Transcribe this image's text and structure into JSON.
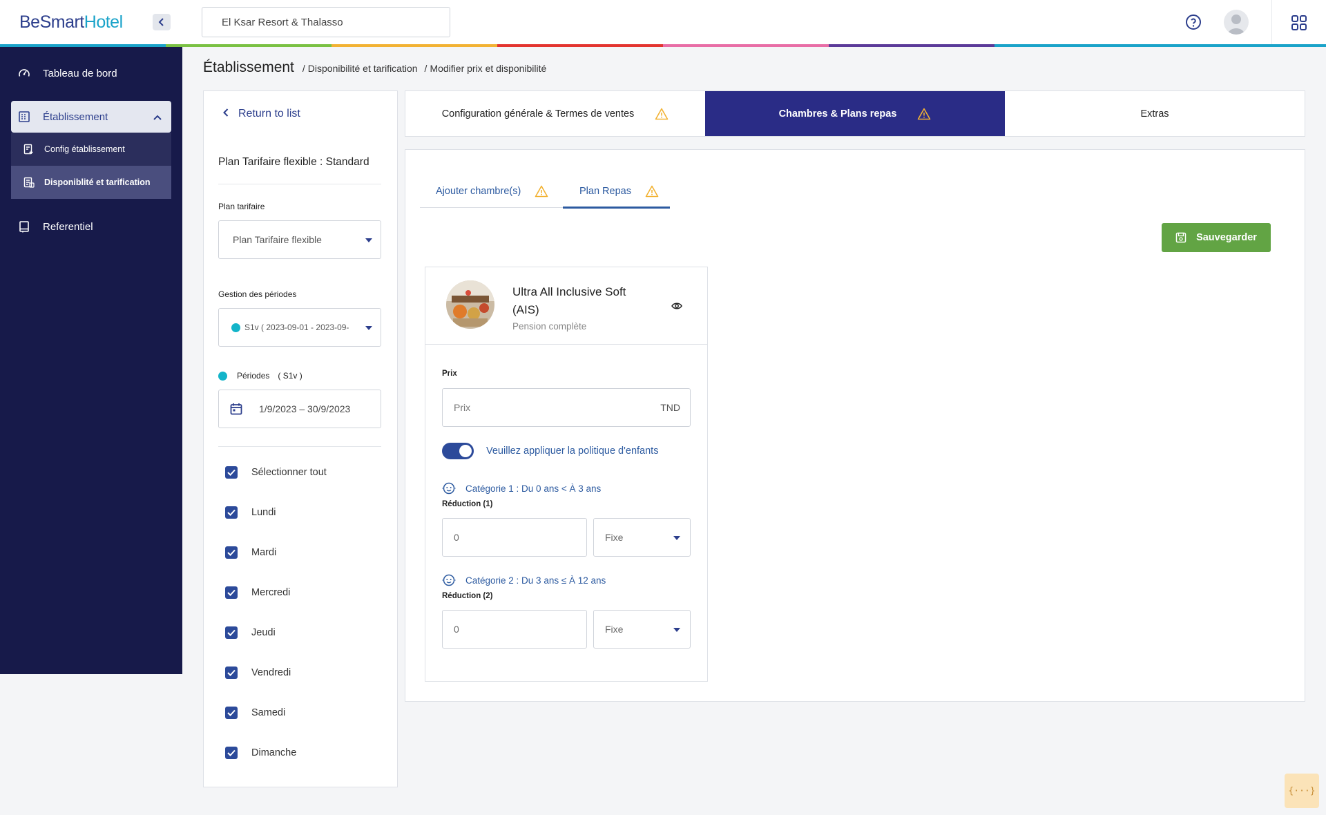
{
  "brand": {
    "part1": "BeSmart",
    "part2": "Hotel"
  },
  "header": {
    "hotel_name": "El Ksar Resort & Thalasso",
    "rainbow_colors": [
      "#1aa3c9",
      "#7ac143",
      "#f2b233",
      "#e3342f",
      "#e86da6",
      "#5b3a99",
      "#1aa3c9",
      "#1aa3c9"
    ]
  },
  "sidebar": {
    "items": [
      {
        "label": "Tableau de bord",
        "icon": "dashboard-icon"
      },
      {
        "label": "Établissement",
        "icon": "building-icon"
      },
      {
        "label": "Referentiel",
        "icon": "book-icon"
      }
    ],
    "sub_items": [
      {
        "label": "Config établissement",
        "icon": "config-icon"
      },
      {
        "label": "Disponiblité et tarification",
        "icon": "pricing-icon"
      }
    ]
  },
  "breadcrumb": {
    "title": "Établissement",
    "sep": "/",
    "crumbs": [
      "Disponibilité et tarification",
      "Modifier prix et disponibilité"
    ]
  },
  "left_panel": {
    "return_label": "Return to list",
    "plan_title": "Plan Tarifaire flexible : Standard",
    "rate_plan_label": "Plan tarifaire",
    "rate_plan_value": "Plan Tarifaire flexible",
    "periods_mgmt_label": "Gestion des périodes",
    "period_select_value": "S1v ( 2023-09-01 - 2023-09-",
    "periods_label": "Périodes",
    "periods_code": "( S1v )",
    "date_range": "1/9/2023 – 30/9/2023",
    "days": [
      "Sélectionner tout",
      "Lundi",
      "Mardi",
      "Mercredi",
      "Jeudi",
      "Vendredi",
      "Samedi",
      "Dimanche"
    ],
    "period_color": "#13b4c9"
  },
  "top_tabs": [
    {
      "label": "Configuration générale & Termes de ventes"
    },
    {
      "label": "Chambres & Plans repas"
    },
    {
      "label": "Extras"
    }
  ],
  "sub_tabs": [
    {
      "label": "Ajouter chambre(s)"
    },
    {
      "label": "Plan Repas"
    }
  ],
  "save_label": "Sauvegarder",
  "meal_plan": {
    "name": "Ultra All Inclusive Soft (AIS)",
    "type": "Pension complète",
    "price_label": "Prix",
    "price_placeholder": "Prix",
    "currency": "TND",
    "child_policy_label": "Veuillez appliquer la politique d'enfants",
    "child_policy_enabled": true,
    "categories": [
      {
        "label": "Catégorie 1 : Du 0 ans < À 3 ans",
        "reduction_label": "Réduction (1)",
        "value": "0",
        "mode": "Fixe"
      },
      {
        "label": "Catégorie 2 : Du 3 ans ≤ À 12 ans",
        "reduction_label": "Réduction (2)",
        "value": "0",
        "mode": "Fixe"
      }
    ]
  },
  "colors": {
    "accent": "#2c3e8c",
    "active_tab": "#2a2c86",
    "save": "#62a444",
    "sidebar": "#171a4a",
    "warning": "#f2b233"
  },
  "corner_widget": "{···}"
}
